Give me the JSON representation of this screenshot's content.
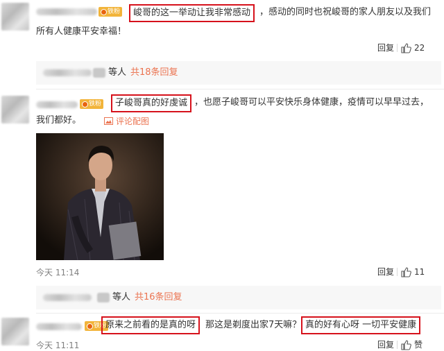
{
  "comments": [
    {
      "badge": "铁粉",
      "text_highlight": "峻哥的这一举动让我非常感动",
      "text_rest_line1": "，感动的同时也祝峻哥的家人朋友以及我们",
      "text_line2": "所有人健康平安幸福！",
      "reply_label": "回复",
      "like_count": "22",
      "sub_summary": {
        "label": "等人",
        "count_text": "共18条回复"
      }
    },
    {
      "badge": "铁粉",
      "text_highlight": "子峻哥真的好虔诚",
      "text_rest_line1": "，也愿子峻哥可以平安快乐身体健康，疫情可以早早过去，",
      "text_line2": "我们都好。",
      "view_image_label": "评论配图",
      "time": "今天 11:14",
      "reply_label": "回复",
      "like_count": "11",
      "sub_summary": {
        "label": "等人",
        "count_text": "共16条回复"
      }
    },
    {
      "badge": "铁粉",
      "text_highlight_1": "原来之前看的是真的呀",
      "text_middle": "那这是剃度出家7天嘛？",
      "text_highlight_2": "真的好有心呀  一切平安健康",
      "time": "今天 11:11",
      "reply_label": "回复",
      "like_count": "赞"
    }
  ],
  "colors": {
    "highlight_border": "#d6111b",
    "link": "#eb7350",
    "badge": "#f2b43a",
    "meta": "#808080"
  },
  "icons": [
    "thumbs-up-icon",
    "image-icon",
    "fan-badge-icon"
  ]
}
